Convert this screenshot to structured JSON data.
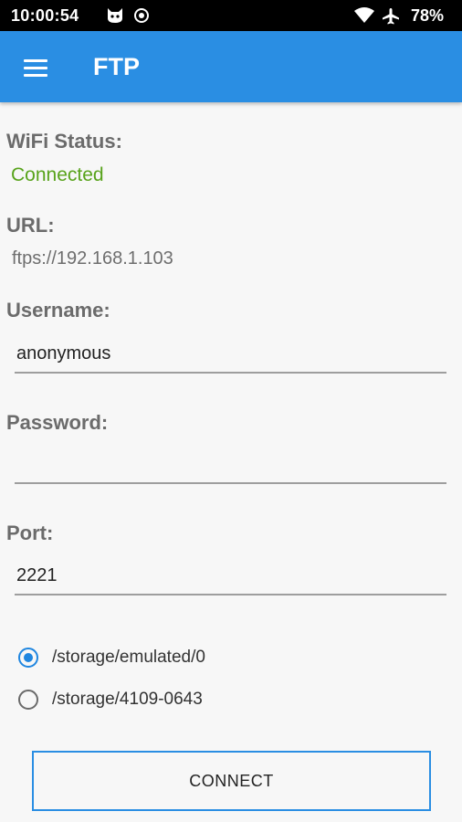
{
  "status_bar": {
    "time": "10:00:54",
    "battery": "78%",
    "icons": [
      "notification-cat-icon",
      "notification-circle-icon",
      "wifi-icon",
      "airplane-mode-icon"
    ]
  },
  "app_bar": {
    "title": "FTP",
    "color": "#2a8ee3"
  },
  "wifi": {
    "label": "WiFi Status:",
    "value": "Connected",
    "value_color": "#58a31b"
  },
  "url": {
    "label": "URL:",
    "value": "ftps://192.168.1.103"
  },
  "username": {
    "label": "Username:",
    "value": "anonymous"
  },
  "password": {
    "label": "Password:",
    "value": ""
  },
  "port": {
    "label": "Port:",
    "value": "2221"
  },
  "storage": {
    "options": [
      {
        "label": "/storage/emulated/0",
        "selected": true
      },
      {
        "label": "/storage/4109-0643",
        "selected": false
      }
    ]
  },
  "connect_button": {
    "label": "CONNECT"
  }
}
